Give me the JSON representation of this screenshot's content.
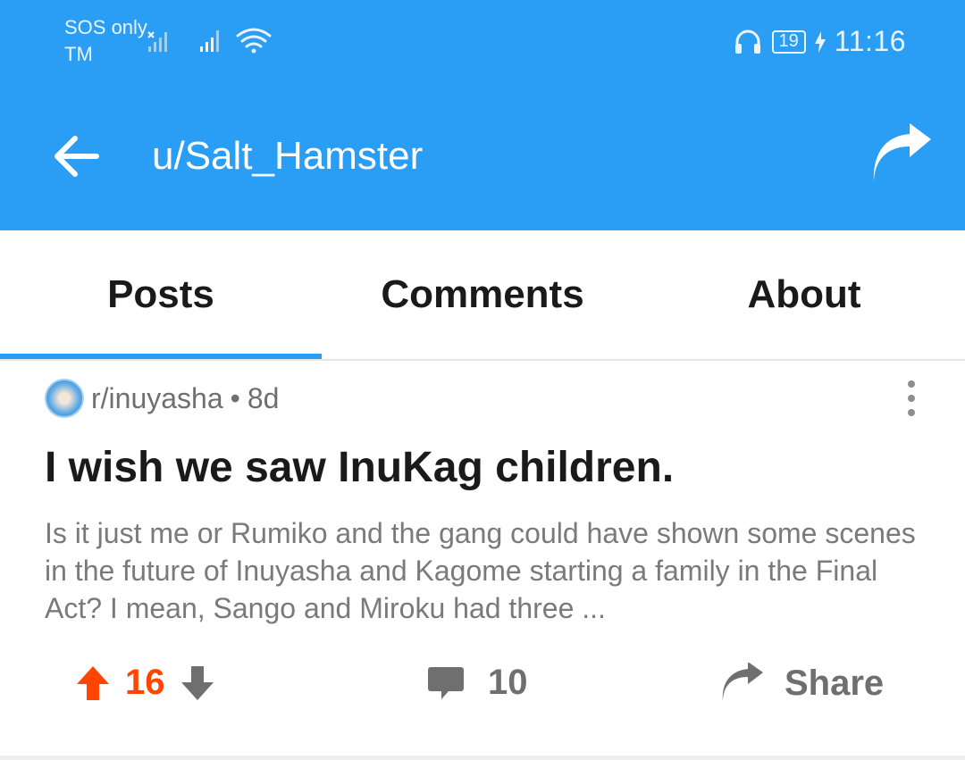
{
  "status_bar": {
    "carrier_line1": "SOS only",
    "carrier_line2": "TM",
    "battery": "19",
    "time": "11:16"
  },
  "header": {
    "title": "u/Salt_Hamster"
  },
  "tabs": [
    {
      "label": "Posts",
      "active": true
    },
    {
      "label": "Comments",
      "active": false
    },
    {
      "label": "About",
      "active": false
    }
  ],
  "post": {
    "subreddit": "r/inuyasha",
    "separator": "•",
    "age": "8d",
    "title": "I wish we saw InuKag children.",
    "body": "Is it just me or Rumiko and the gang could have shown some scenes in the future of Inuyasha and Kagome starting a family in the Final Act? I mean, Sango and Miroku had three ...",
    "score": "16",
    "comment_count": "10",
    "share_label": "Share"
  },
  "colors": {
    "header": "#2a9df4",
    "upvote": "#ff4500",
    "tab_indicator": "#2a9df4"
  }
}
